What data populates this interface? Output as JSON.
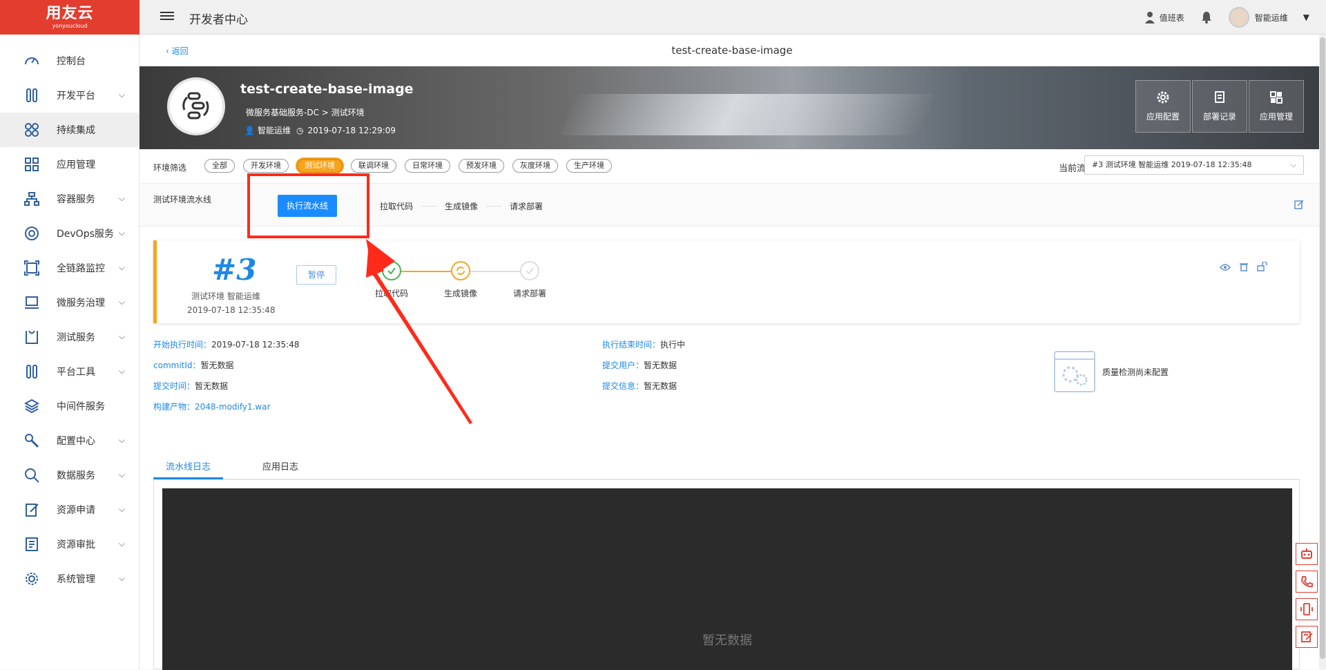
{
  "logo": {
    "main": "用友云",
    "sub": "yonyoucloud"
  },
  "header": {
    "title": "开发者中心",
    "duty_label": "值班表",
    "user_name": "智能运维"
  },
  "sidebar": {
    "items": [
      {
        "label": "控制台"
      },
      {
        "label": "开发平台"
      },
      {
        "label": "持续集成"
      },
      {
        "label": "应用管理"
      },
      {
        "label": "容器服务"
      },
      {
        "label": "DevOps服务"
      },
      {
        "label": "全链路监控"
      },
      {
        "label": "微服务治理"
      },
      {
        "label": "测试服务"
      },
      {
        "label": "平台工具"
      },
      {
        "label": "中间件服务"
      },
      {
        "label": "配置中心"
      },
      {
        "label": "数据服务"
      },
      {
        "label": "资源申请"
      },
      {
        "label": "资源审批"
      },
      {
        "label": "系统管理"
      }
    ]
  },
  "page": {
    "back_label": "返回",
    "title": "test-create-base-image"
  },
  "app": {
    "name": "test-create-base-image",
    "path": "微服务基础服务-DC > 测试环境",
    "owner": "智能运维",
    "created": "2019-07-18 12:29:09",
    "actions": [
      {
        "label": "应用配置"
      },
      {
        "label": "部署记录"
      },
      {
        "label": "应用管理"
      }
    ]
  },
  "filter": {
    "label": "环境筛选",
    "chips": [
      "全部",
      "开发环境",
      "测试环境",
      "联调环境",
      "日常环境",
      "预发环境",
      "灰度环境",
      "生产环境"
    ],
    "selected": "测试环境",
    "pipeline_label": "当前流水线",
    "pipeline_value": "#3 测试环境 智能运维 2019-07-18 12:35:48"
  },
  "stage_bar": {
    "title": "测试环境流水线",
    "run_button": "执行流水线",
    "steps": [
      "拉取代码",
      "生成镜像",
      "请求部署"
    ]
  },
  "run": {
    "number": "#3",
    "env_user": "测试环境 智能运维",
    "time": "2019-07-18 12:35:48",
    "pause_label": "暂停",
    "steps": [
      {
        "label": "拉取代码",
        "status": "done"
      },
      {
        "label": "生成镜像",
        "status": "running"
      },
      {
        "label": "请求部署",
        "status": "pending"
      }
    ]
  },
  "info": {
    "start_label": "开始执行时间：",
    "start_value": "2019-07-18 12:35:48",
    "end_label": "执行结束时间：",
    "end_value": "执行中",
    "commit_label": "commitId：",
    "commit_value": "暂无数据",
    "submit_user_label": "提交用户：",
    "submit_user_value": "暂无数据",
    "submit_time_label": "提交时间：",
    "submit_time_value": "暂无数据",
    "submit_msg_label": "提交信息：",
    "submit_msg_value": "暂无数据",
    "artifact_label": "构建产物：",
    "artifact_value": "2048-modify1.war",
    "quality_text": "质量检测尚未配置"
  },
  "logs": {
    "tabs": [
      "流水线日志",
      "应用日志"
    ],
    "empty": "暂无数据"
  },
  "colors": {
    "brand_red": "#e23d2e",
    "accent_blue": "#1e88e5",
    "selected_orange": "#f7a41d"
  }
}
